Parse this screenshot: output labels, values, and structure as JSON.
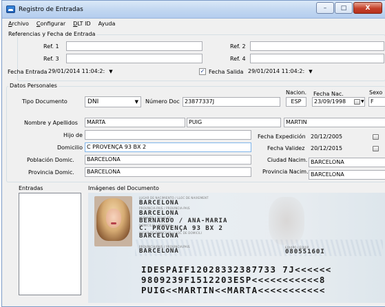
{
  "window": {
    "title": "Registro de Entradas",
    "controls": {
      "minimize": "–",
      "maximize": "□",
      "close": "X"
    }
  },
  "menu": [
    {
      "label": "Archivo",
      "underline": "A",
      "rest": "rchivo"
    },
    {
      "label": "Configurar",
      "underline": "C",
      "rest": "onfigurar"
    },
    {
      "label": "DLT ID",
      "underline": "D",
      "rest": "LT ID"
    },
    {
      "label": "Ayuda",
      "underline": "",
      "rest": "Ayuda"
    }
  ],
  "refs": {
    "group_label": "Referencias y Fecha de Entrada",
    "ref1_label": "Ref. 1",
    "ref1_value": "",
    "ref2_label": "Ref. 2",
    "ref2_value": "",
    "ref3_label": "Ref. 3",
    "ref3_value": "",
    "ref4_label": "Ref. 4",
    "ref4_value": "",
    "fecha_entrada_label": "Fecha Entrada",
    "fecha_entrada_value": "29/01/2014 11:04:2:",
    "fecha_salida_label": "Fecha Salida",
    "fecha_salida_checked": true,
    "fecha_salida_value": "29/01/2014 11:04:2:"
  },
  "personal": {
    "group_label": "Datos Personales",
    "tipo_doc_label": "Tipo Documento",
    "tipo_doc_value": "DNI",
    "num_doc_label": "Número Doc",
    "num_doc_value": "23877337J",
    "nacion_label": "Nacion.",
    "nacion_value": "ESP",
    "fecha_nac_label": "Fecha Nac.",
    "fecha_nac_value": "23/09/1998",
    "sexo_label": "Sexo",
    "sexo_value": "F",
    "nombre_label": "Nombre y Apellidos",
    "nombre_value": "MARTA",
    "apellido1_value": "PUIG",
    "apellido2_value": "MARTIN",
    "hijo_de_label": "Hijo de",
    "hijo_de_value": "",
    "fecha_exp_label": "Fecha Expedición",
    "fecha_exp_value": "20/12/2005",
    "domicilio_label": "Domicilio",
    "domicilio_value": "C PROVENÇA 93 BX 2",
    "fecha_val_label": "Fecha Validez",
    "fecha_val_value": "20/12/2015",
    "poblacion_label": "Población Domic.",
    "poblacion_value": "BARCELONA",
    "ciudad_nac_label": "Ciudad Nacim.",
    "ciudad_nac_value": "BARCELONA",
    "provincia_label": "Provincia Domic.",
    "provincia_value": "BARCELONA",
    "provincia_nac_label": "Provincia Nacim.",
    "provincia_nac_value": "BARCELONA"
  },
  "entradas": {
    "label": "Entradas"
  },
  "documento": {
    "label": "Imágenes del Documento",
    "card_line1_small": "LUGAR DE NACIMIENTO / LLOC DE NAIXEMENT",
    "card_line1": "BARCELONA",
    "card_line2_small": "PROVINCIA-PAIS / PROVINCIA-PAIS",
    "card_line2": "BARCELONA",
    "card_line3_small": "HIJO/A DE / FILL/A DE",
    "card_line3": "BERNARDO / ANA-MARIA",
    "card_line4_small": "DOMICILIO / DOMICILI",
    "card_line4": "C. PROVENÇA 93 BX 2",
    "card_line5_small": "LUGAR DE DOMICILIO / LLOC DE DOMICILI",
    "card_line5": "BARCELONA",
    "card_line6_small": "PROVINCIA/PAIS / PROVINCIA/PAIS",
    "card_line6": "BARCELONA",
    "card_equipo_small": "EQUIPO / EQUIP",
    "card_equipo": "08055160I",
    "mrz1": "IDESPAIF12028332387733 7J<<<<<<",
    "mrz2": "9809239F1512203ESP<<<<<<<<<<<8",
    "mrz3": "PUIG<<MARTIN<<MARTA<<<<<<<<<<<"
  }
}
